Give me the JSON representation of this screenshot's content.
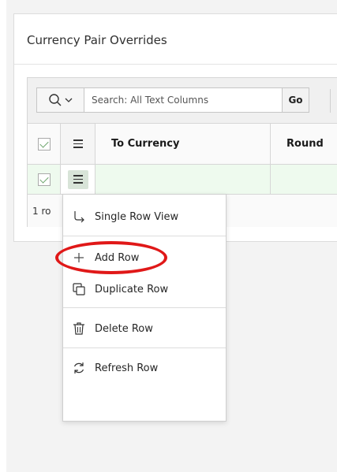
{
  "region": {
    "title": "Currency Pair Overrides"
  },
  "toolbar": {
    "search_placeholder": "Search: All Text Columns",
    "go_label": "Go",
    "search_icon": "search-icon",
    "dropdown_icon": "chevron-down-icon"
  },
  "grid": {
    "columns": [
      "To Currency",
      "Round"
    ],
    "rows": [
      {
        "selected": true,
        "to_currency": "",
        "round": ""
      }
    ],
    "footer_text": "1 ro"
  },
  "row_menu": {
    "items": [
      {
        "label": "Single Row View",
        "icon": "single-row-view-icon"
      },
      {
        "label": "Add Row",
        "icon": "plus-icon"
      },
      {
        "label": "Duplicate Row",
        "icon": "duplicate-icon"
      },
      {
        "label": "Delete Row",
        "icon": "trash-icon"
      },
      {
        "label": "Refresh Row",
        "icon": "refresh-icon"
      }
    ]
  },
  "annotation": {
    "color": "#e01818",
    "target": "Add Row"
  },
  "colors": {
    "row_selected_bg": "#eefaee",
    "menu_button_bg": "#d8e4d8"
  }
}
